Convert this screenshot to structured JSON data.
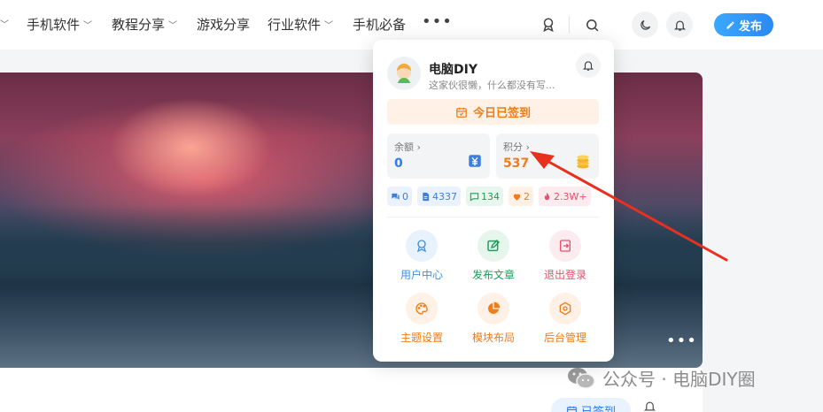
{
  "nav": {
    "items": [
      {
        "label": "手机软件",
        "has_dropdown": true
      },
      {
        "label": "教程分享",
        "has_dropdown": true
      },
      {
        "label": "游戏分享",
        "has_dropdown": false
      },
      {
        "label": "行业软件",
        "has_dropdown": true
      },
      {
        "label": "手机必备",
        "has_dropdown": false
      }
    ],
    "more_label": "•••",
    "publish_label": "发布"
  },
  "hero": {
    "more_label": "•••"
  },
  "user_card": {
    "name": "电脑DIY",
    "bio": "这家伙很懒，什么都没有写...",
    "signin_label": "今日已签到",
    "balance": {
      "label": "余额",
      "value": "0"
    },
    "points": {
      "label": "积分",
      "value": "537"
    },
    "chips": [
      {
        "icon": "comments-icon",
        "value": "0",
        "color": "#3d7fe0",
        "bg": "#eaf2ff"
      },
      {
        "icon": "document-icon",
        "value": "4337",
        "color": "#3d7fe0",
        "bg": "#eaf2ff"
      },
      {
        "icon": "message-icon",
        "value": "134",
        "color": "#1f9d5a",
        "bg": "#e8f7ee"
      },
      {
        "icon": "heart-icon",
        "value": "2",
        "color": "#f07c1a",
        "bg": "#fff1e6"
      },
      {
        "icon": "fire-icon",
        "value": "2.3W+",
        "color": "#ee4d6b",
        "bg": "#fdecef"
      }
    ],
    "menu": [
      {
        "label": "用户中心",
        "icon": "user-center-icon",
        "color": "#3d8fe8",
        "bg": "#e8f2fc"
      },
      {
        "label": "发布文章",
        "icon": "edit-icon",
        "color": "#1f9d5a",
        "bg": "#e6f6ec"
      },
      {
        "label": "退出登录",
        "icon": "logout-icon",
        "color": "#ee4d6b",
        "bg": "#fdecef"
      },
      {
        "label": "主题设置",
        "icon": "palette-icon",
        "color": "#f07c1a",
        "bg": "#fff1e6"
      },
      {
        "label": "模块布局",
        "icon": "pie-icon",
        "color": "#f07c1a",
        "bg": "#fff1e6"
      },
      {
        "label": "后台管理",
        "icon": "gear-icon",
        "color": "#f07c1a",
        "bg": "#fff1e6"
      }
    ]
  },
  "bottom": {
    "checked_label": "已签到"
  },
  "watermark": {
    "text": "公众号 · 电脑DIY圈"
  },
  "colors": {
    "accent": "#2b89f5",
    "orange": "#f07c1a",
    "arrow": "#e8301f"
  }
}
